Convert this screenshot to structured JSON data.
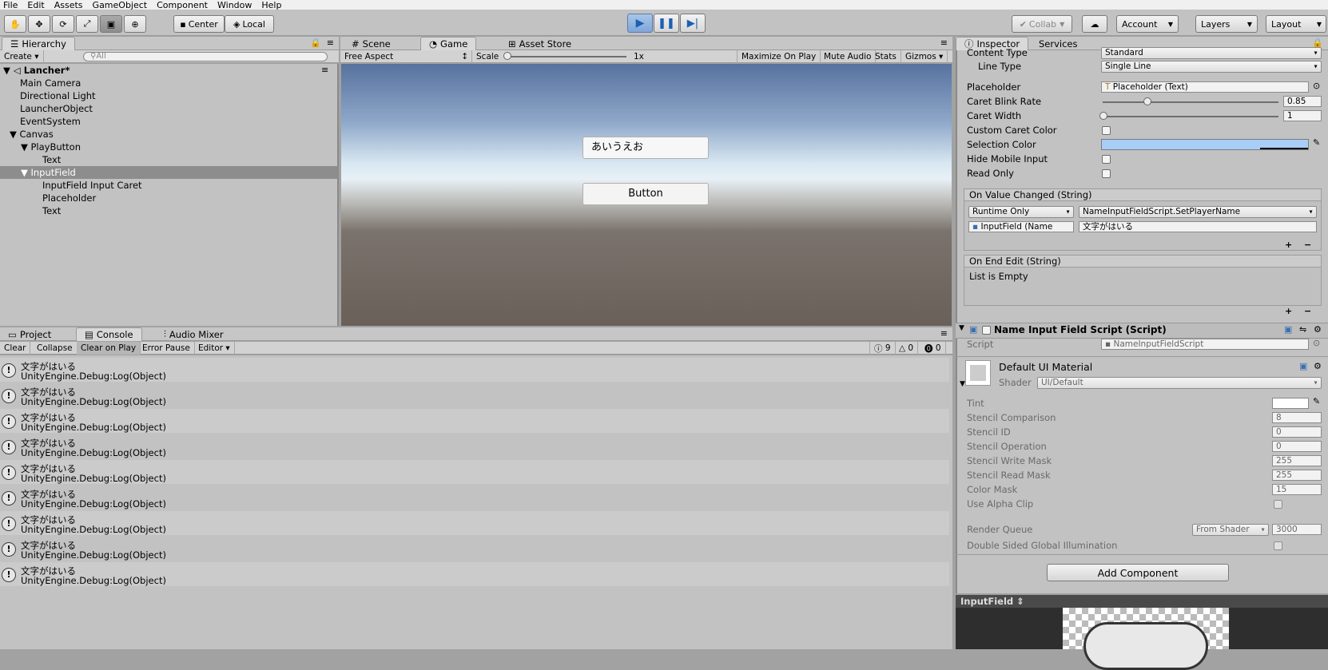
{
  "menu": [
    "File",
    "Edit",
    "Assets",
    "GameObject",
    "Component",
    "Window",
    "Help"
  ],
  "toolbar": {
    "tools": [
      "hand-icon",
      "move-icon",
      "rotate-icon",
      "scale-icon",
      "rect-tool-icon",
      "transform-icon"
    ],
    "center": "Center",
    "local": "Local",
    "collab": "Collab",
    "account": "Account",
    "layers": "Layers",
    "layout": "Layout"
  },
  "hierarchy": {
    "tab": "Hierarchy",
    "create": "Create",
    "search_placeholder": "All",
    "scene": "Lancher*",
    "items": [
      "Main Camera",
      "Directional Light",
      "LauncherObject",
      "EventSystem",
      "Canvas",
      "PlayButton",
      "Text",
      "InputField",
      "InputField Input Caret",
      "Placeholder",
      "Text"
    ]
  },
  "game": {
    "tabs": [
      "Scene",
      "Game",
      "Asset Store"
    ],
    "aspect": "Free Aspect",
    "scale_label": "Scale",
    "scale_value": "1x",
    "maximize": "Maximize On Play",
    "mute": "Mute Audio",
    "stats": "Stats",
    "gizmos": "Gizmos",
    "input_text": "あいうえお",
    "button_text": "Button"
  },
  "console": {
    "tabs": [
      "Project",
      "Console",
      "Audio Mixer"
    ],
    "buttons": [
      "Clear",
      "Collapse",
      "Clear on Play",
      "Error Pause",
      "Editor"
    ],
    "counts": [
      "9",
      "0",
      "0"
    ],
    "logs": [
      {
        "message": "文字がはいる",
        "trace": "UnityEngine.Debug:Log(Object)"
      },
      {
        "message": "文字がはいる",
        "trace": "UnityEngine.Debug:Log(Object)"
      },
      {
        "message": "文字がはいる",
        "trace": "UnityEngine.Debug:Log(Object)"
      },
      {
        "message": "文字がはいる",
        "trace": "UnityEngine.Debug:Log(Object)"
      },
      {
        "message": "文字がはいる",
        "trace": "UnityEngine.Debug:Log(Object)"
      },
      {
        "message": "文字がはいる",
        "trace": "UnityEngine.Debug:Log(Object)"
      },
      {
        "message": "文字がはいる",
        "trace": "UnityEngine.Debug:Log(Object)"
      },
      {
        "message": "文字がはいる",
        "trace": "UnityEngine.Debug:Log(Object)"
      },
      {
        "message": "文字がはいる",
        "trace": "UnityEngine.Debug:Log(Object)"
      }
    ]
  },
  "inspector": {
    "tabs": [
      "Inspector",
      "Services"
    ],
    "content_type_label": "Content Type",
    "content_type": "Standard",
    "line_type_label": "Line Type",
    "line_type": "Single Line",
    "placeholder_label": "Placeholder",
    "placeholder_value": "Placeholder (Text)",
    "caret_blink_label": "Caret Blink Rate",
    "caret_blink": "0.85",
    "caret_blink_fraction": 0.25,
    "caret_width_label": "Caret Width",
    "caret_width": "1",
    "caret_width_fraction": 0.0,
    "custom_caret_label": "Custom Caret Color",
    "selection_color_label": "Selection Color",
    "selection_color": "#a8cef8",
    "hide_mobile_label": "Hide Mobile Input",
    "read_only_label": "Read Only",
    "on_value_changed": "On Value Changed (String)",
    "runtime": "Runtime Only",
    "method": "NameInputFieldScript.SetPlayerName",
    "object": "InputField (Name",
    "arg": "文字がはいる",
    "on_end_edit": "On End Edit (String)",
    "list_empty": "List is Empty",
    "script_title": "Name Input Field Script (Script)",
    "script_label": "Script",
    "script_value": "NameInputFieldScript",
    "material": "Default UI Material",
    "shader_label": "Shader",
    "shader": "UI/Default",
    "tint_label": "Tint",
    "props": [
      {
        "label": "Stencil Comparison",
        "value": "8"
      },
      {
        "label": "Stencil ID",
        "value": "0"
      },
      {
        "label": "Stencil Operation",
        "value": "0"
      },
      {
        "label": "Stencil Write Mask",
        "value": "255"
      },
      {
        "label": "Stencil Read Mask",
        "value": "255"
      },
      {
        "label": "Color Mask",
        "value": "15"
      }
    ],
    "alpha_clip_label": "Use Alpha Clip",
    "render_queue_label": "Render Queue",
    "render_queue_mode": "From Shader",
    "render_queue": "3000",
    "dsgi_label": "Double Sided Global Illumination",
    "add_component": "Add Component",
    "preview": "InputField"
  }
}
